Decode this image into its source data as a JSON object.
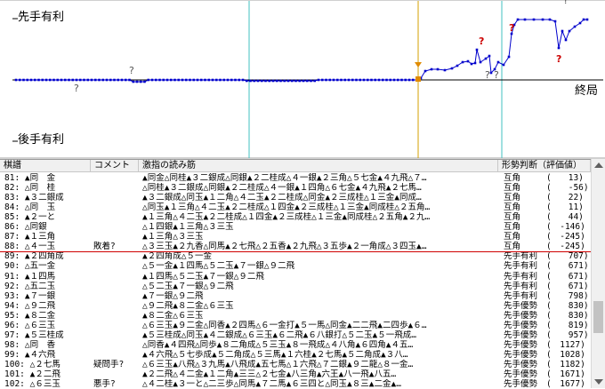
{
  "graph": {
    "label_top": "先手有利",
    "label_bottom": "後手有利",
    "label_end": "終局",
    "question_mark": "?",
    "colors": {
      "line": "#0000cc",
      "highlight": "#e08a00",
      "cursor": "#d4a000",
      "axis_mark": "#40c0c0",
      "q_gray": "#555555",
      "q_red": "#cc0000"
    }
  },
  "table": {
    "headers": [
      "棋譜",
      "コメント",
      "激指の読み筋",
      "形勢判断（評価値）"
    ],
    "rows": [
      {
        "move": "81: ▲同　金",
        "comment": "",
        "line": "▲同金△同桂▲３二銀成△同銀▲２二桂成△４一銀▲２三角△５七金▲４九飛△７…",
        "judge": "互角",
        "value": "(　　13)"
      },
      {
        "move": "82: △同　桂",
        "comment": "",
        "line": "△同桂▲３二銀成△同銀▲２二桂成△４一銀▲１四角△６七金▲４九飛▲２七馬…",
        "judge": "互角",
        "value": "(　　-56)"
      },
      {
        "move": "83: ▲３二銀成",
        "comment": "",
        "line": "▲３二銀成△同玉▲１二角△４二玉▲２二桂成△同金▲２三成桂△１三金▲同成…",
        "judge": "互角",
        "value": "(　　22)"
      },
      {
        "move": "84: △同　玉",
        "comment": "",
        "line": "△同玉▲１三角△４二玉▲２二桂成△１四金▲２三成桂△１三金▲同成桂△２五角…",
        "judge": "互角",
        "value": "(　　11)"
      },
      {
        "move": "85: ▲２一と",
        "comment": "",
        "line": "▲１三角△４二玉▲２二桂成△１四金▲２三成桂△１三金▲同成桂△２五角▲２九…",
        "judge": "互角",
        "value": "(　　44)"
      },
      {
        "move": "86: △同銀",
        "comment": "",
        "line": "△１四銀▲１三角△３三玉",
        "judge": "互角",
        "value": "(　-146)"
      },
      {
        "move": "87: ▲１三角",
        "comment": "",
        "line": "▲１三角△３三玉",
        "judge": "互角",
        "value": "(　-245)"
      },
      {
        "move": "88: △４一玉",
        "comment": "敗着?",
        "line": "△３三玉▲２九香△同馬▲２七飛△２五香▲２九飛△３五歩▲２一角成△３四玉▲…",
        "judge": "互角",
        "value": "(　-245)"
      },
      {
        "move": "89: ▲２四角成",
        "comment": "",
        "line": "▲２四角成△５一金",
        "judge": "先手有利",
        "value": "(　　707)"
      },
      {
        "move": "90: △五一金",
        "comment": "",
        "line": "△５一金▲１四馬△５二玉▲７一銀△９二飛",
        "judge": "先手有利",
        "value": "(　　671)"
      },
      {
        "move": "91: ▲１四馬",
        "comment": "",
        "line": "▲１四馬△５二玉▲７一銀△９二飛",
        "judge": "先手有利",
        "value": "(　　671)"
      },
      {
        "move": "92: △五二玉",
        "comment": "",
        "line": "△５二玉▲７一銀△９二飛",
        "judge": "先手有利",
        "value": "(　　671)"
      },
      {
        "move": "93: ▲７一銀",
        "comment": "",
        "line": "▲７一銀△９二飛",
        "judge": "先手有利",
        "value": "(　　798)"
      },
      {
        "move": "94: △９二飛",
        "comment": "",
        "line": "△９二飛▲８二金△６三玉",
        "judge": "先手優勢",
        "value": "(　　830)"
      },
      {
        "move": "95: ▲８二金",
        "comment": "",
        "line": "▲８二金△６三玉",
        "judge": "先手優勢",
        "value": "(　　830)"
      },
      {
        "move": "96: △６三玉",
        "comment": "",
        "line": "△６三玉▲９二金△同香▲２四馬△６一金打▲５一馬△同金▲二二飛▲二四歩▲６…",
        "judge": "先手優勢",
        "value": "(　　819)"
      },
      {
        "move": "97: ▲５三桂成",
        "comment": "",
        "line": "▲５三桂成△同玉▲４二銀成△６三玉▲６二飛▲６八銀打△５二玉▲５一飛成…",
        "judge": "先手優勢",
        "value": "(　　957)"
      },
      {
        "move": "98: △同　香",
        "comment": "",
        "line": "△同香▲４四飛△同歩▲８二角成△５三玉▲８一飛成△４八角▲６四角▲４五…",
        "judge": "先手優勢",
        "value": "(　1127)"
      },
      {
        "move": "99: ▲４六飛",
        "comment": "",
        "line": "▲４六飛△５七歩成▲５二角成△５三馬▲１六桂▲２七馬▲５二角成▲３八…",
        "judge": "先手優勢",
        "value": "(　1028)"
      },
      {
        "move": "100: △２七馬",
        "comment": "疑問手?",
        "line": "△６三玉▲八飛△３九馬▲八飛成▲五七馬△１六飛△７二銀▲９二龍△８一金…",
        "judge": "先手優勢",
        "value": "(　1182)"
      },
      {
        "move": "101: ▲２二飛",
        "comment": "",
        "line": "▲２二飛△４二金▲１二角▲三三△２七金▲八三角▲六王▲八一飛▲八五…",
        "judge": "先手優勢",
        "value": "(　1671)"
      },
      {
        "move": "102: △６三玉",
        "comment": "悪手?",
        "line": "△４二桂▲３一と△二三歩△同馬▲７二馬▲６三四と△同玉▲８三▲二金▲…",
        "judge": "先手優勢",
        "value": "(　1677)"
      }
    ]
  }
}
